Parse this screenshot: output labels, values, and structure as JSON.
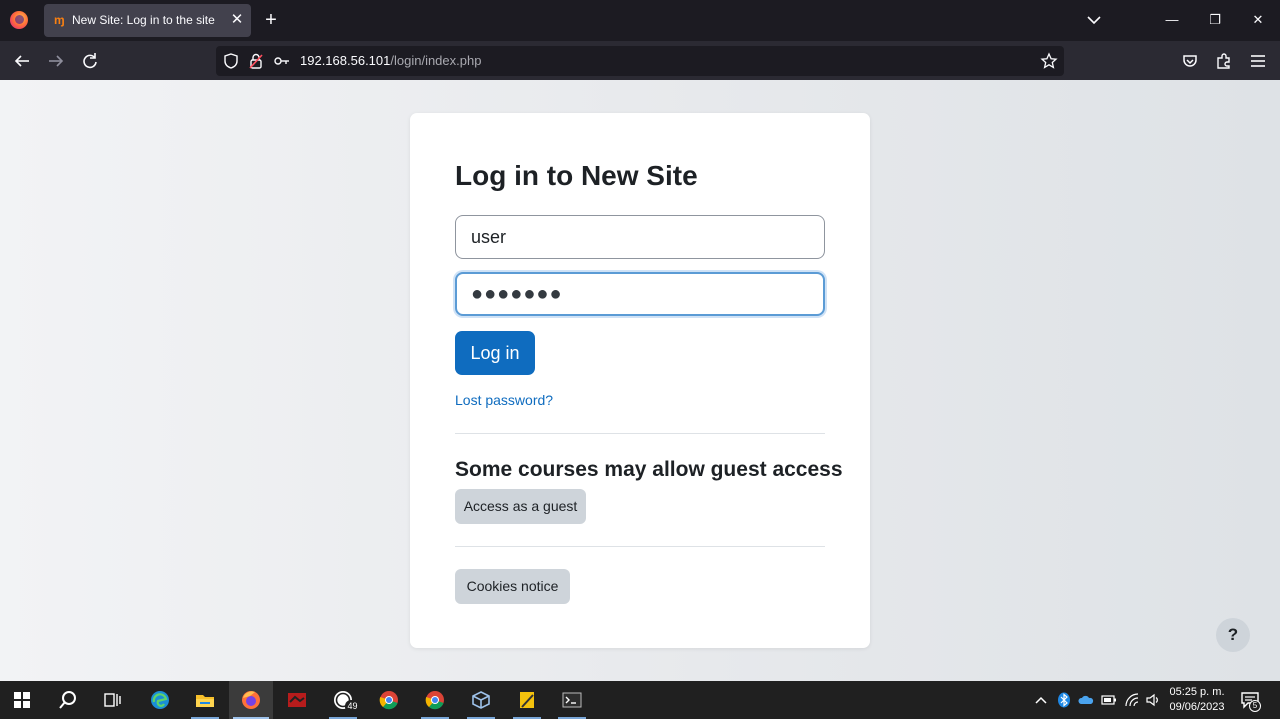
{
  "browser": {
    "tab": {
      "title": "New Site: Log in to the site",
      "favicon": "moodle-icon",
      "favicon_glyph": "ɱ",
      "close_glyph": "✕"
    },
    "new_tab_glyph": "+",
    "window_controls": {
      "minimize": "—",
      "restore": "❐",
      "close": "✕"
    },
    "url": {
      "host": "192.168.56.101",
      "path": "/login/index.php"
    }
  },
  "page": {
    "title": "Log in to New Site",
    "username": {
      "value": "user"
    },
    "password": {
      "masked": "●●●●●●●"
    },
    "login_button": "Log in",
    "lost_password": "Lost password?",
    "guest_heading": "Some courses may allow guest access",
    "guest_button": "Access as a guest",
    "cookies_button": "Cookies notice",
    "help_button": "?",
    "colors": {
      "primary": "#0f6cbf",
      "secondary": "#ced4da",
      "text": "#1d2125"
    }
  },
  "taskbar": {
    "apps": [
      {
        "name": "start-icon"
      },
      {
        "name": "search-icon"
      },
      {
        "name": "task-view-icon"
      },
      {
        "name": "edge-icon"
      },
      {
        "name": "file-explorer-icon"
      },
      {
        "name": "firefox-icon",
        "active": true
      },
      {
        "name": "app-icon"
      },
      {
        "name": "whatsapp-icon",
        "badge": "49"
      },
      {
        "name": "chrome-icon"
      },
      {
        "name": "chrome-icon"
      },
      {
        "name": "virtualbox-icon"
      },
      {
        "name": "notes-icon"
      },
      {
        "name": "terminal-icon"
      }
    ],
    "clock": {
      "time": "05:25 p. m.",
      "date": "09/06/2023"
    },
    "notifications": "5"
  }
}
